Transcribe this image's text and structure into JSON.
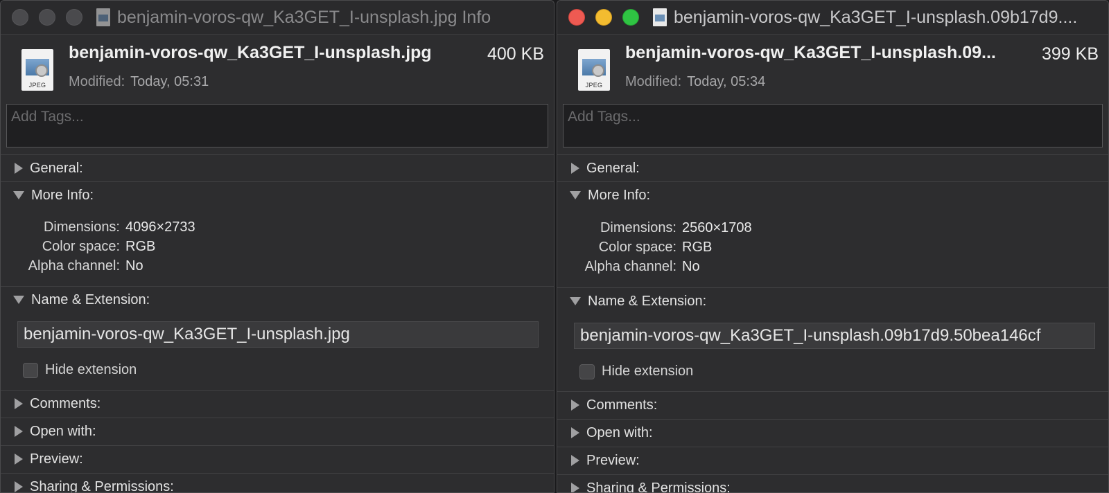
{
  "left_window": {
    "title": "benjamin-voros-qw_Ka3GET_I-unsplash.jpg Info",
    "file_name": "benjamin-voros-qw_Ka3GET_I-unsplash.jpg",
    "file_size": "400 KB",
    "icon_ext": "JPEG",
    "modified_label": "Modified:",
    "modified_value": "Today, 05:31",
    "tags_placeholder": "Add Tags...",
    "sections": {
      "general": "General:",
      "more_info": "More Info:",
      "name_ext": "Name & Extension:",
      "comments": "Comments:",
      "open_with": "Open with:",
      "preview": "Preview:",
      "sharing": "Sharing & Permissions:"
    },
    "more_info": {
      "dimensions_label": "Dimensions:",
      "dimensions_value": "4096×2733",
      "color_space_label": "Color space:",
      "color_space_value": "RGB",
      "alpha_label": "Alpha channel:",
      "alpha_value": "No"
    },
    "name_field_value": "benjamin-voros-qw_Ka3GET_I-unsplash.jpg",
    "hide_extension_label": "Hide extension"
  },
  "right_window": {
    "title": "benjamin-voros-qw_Ka3GET_I-unsplash.09b17d9....",
    "file_name": "benjamin-voros-qw_Ka3GET_I-unsplash.09...",
    "file_size": "399 KB",
    "icon_ext": "JPEG",
    "modified_label": "Modified:",
    "modified_value": "Today, 05:34",
    "tags_placeholder": "Add Tags...",
    "sections": {
      "general": "General:",
      "more_info": "More Info:",
      "name_ext": "Name & Extension:",
      "comments": "Comments:",
      "open_with": "Open with:",
      "preview": "Preview:",
      "sharing": "Sharing & Permissions:"
    },
    "more_info": {
      "dimensions_label": "Dimensions:",
      "dimensions_value": "2560×1708",
      "color_space_label": "Color space:",
      "color_space_value": "RGB",
      "alpha_label": "Alpha channel:",
      "alpha_value": "No"
    },
    "name_field_value": "benjamin-voros-qw_Ka3GET_I-unsplash.09b17d9.50bea146cf",
    "hide_extension_label": "Hide extension"
  },
  "colors": {
    "close": "#ee5a52",
    "minimize": "#f3bc30",
    "zoom": "#2fc443",
    "window_bg": "#2d2d2f"
  }
}
